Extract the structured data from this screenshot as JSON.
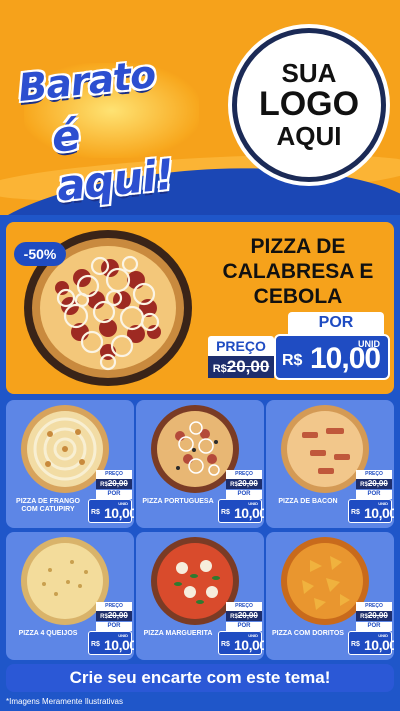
{
  "header": {
    "brand_line1": "Barato",
    "brand_line2": "é aqui!",
    "logo_line1": "SUA",
    "logo_line2": "LOGO",
    "logo_line3": "AQUI"
  },
  "featured": {
    "discount": "-50%",
    "title": "PIZZA DE CALABRESA E CEBOLA",
    "preco_label": "PREÇO",
    "por_label": "POR",
    "old_currency": "R$",
    "old_price": "20,00",
    "unid_label": "UNID",
    "new_currency": "R$",
    "new_price": "10,00"
  },
  "products": [
    {
      "name": "PIZZA DE FRANGO COM CATUPIRY",
      "preco_label": "PREÇO",
      "old_currency": "R$",
      "old_price": "20,00",
      "por_label": "POR",
      "unid_label": "UNID",
      "currency": "R$",
      "price": "10,00"
    },
    {
      "name": "PIZZA PORTUGUESA",
      "preco_label": "PREÇO",
      "old_currency": "R$",
      "old_price": "20,00",
      "por_label": "POR",
      "unid_label": "UNID",
      "currency": "R$",
      "price": "10,00"
    },
    {
      "name": "PIZZA DE BACON",
      "preco_label": "PREÇO",
      "old_currency": "R$",
      "old_price": "20,00",
      "por_label": "POR",
      "unid_label": "UNID",
      "currency": "R$",
      "price": "10,00"
    },
    {
      "name": "PIZZA 4 QUEIJOS",
      "preco_label": "PREÇO",
      "old_currency": "R$",
      "old_price": "20,00",
      "por_label": "POR",
      "unid_label": "UNID",
      "currency": "R$",
      "price": "10,00"
    },
    {
      "name": "PIZZA MARGUERITA",
      "preco_label": "PREÇO",
      "old_currency": "R$",
      "old_price": "20,00",
      "por_label": "POR",
      "unid_label": "UNID",
      "currency": "R$",
      "price": "10,00"
    },
    {
      "name": "PIZZA COM DORITOS",
      "preco_label": "PREÇO",
      "old_currency": "R$",
      "old_price": "20,00",
      "por_label": "POR",
      "unid_label": "UNID",
      "currency": "R$",
      "price": "10,00"
    }
  ],
  "footer": {
    "cta": "Crie seu encarte com este tema!",
    "disclaimer": "*Imagens Meramente Ilustrativas"
  },
  "colors": {
    "orange": "#f6a21b",
    "blue": "#1f4cc2",
    "navy": "#1d2e6d",
    "card": "#5d86e6"
  },
  "icons": [
    "pizza-calabresa-image",
    "pizza-frango-image",
    "pizza-portuguesa-image",
    "pizza-bacon-image",
    "pizza-4-queijos-image",
    "pizza-marguerita-image",
    "pizza-doritos-image"
  ]
}
